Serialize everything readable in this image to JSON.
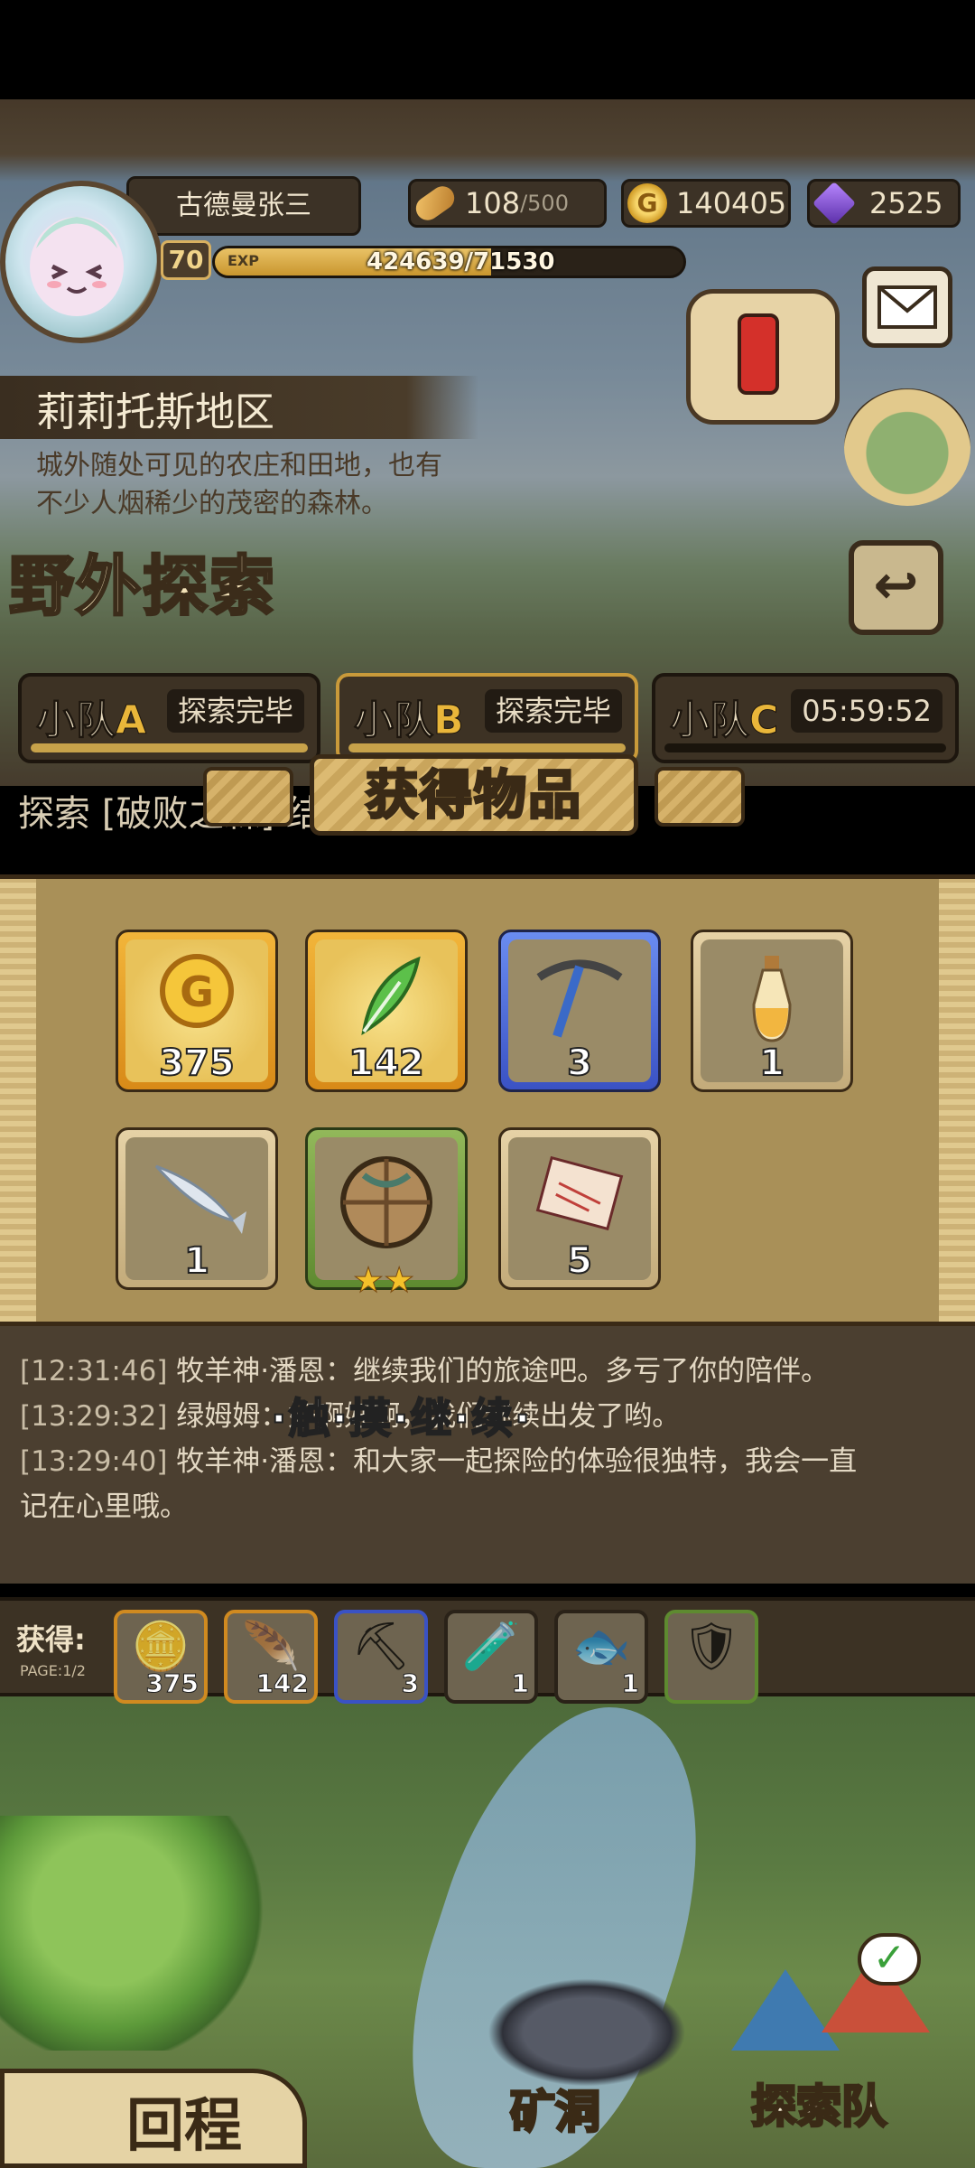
{
  "player": {
    "name": "古德曼张三",
    "level": "70",
    "exp_label": "EXP",
    "exp_value": "424639/71530",
    "exp_progress": 0.59
  },
  "resources": {
    "stamina_current": "108",
    "stamina_max": "/500",
    "gold": "140405",
    "gems": "2525",
    "gold_icon_glyph": "G"
  },
  "region": {
    "name": "莉莉托斯地区",
    "description_line1": "城外随处可见的农庄和田地，也有",
    "description_line2": "不少人烟稀少的茂密的森林。",
    "mode_title": "野外探索"
  },
  "squads": [
    {
      "prefix": "小队",
      "letter": "A",
      "status": "探索完毕",
      "progress": 1.0
    },
    {
      "prefix": "小队",
      "letter": "B",
      "status": "探索完毕",
      "progress": 1.0
    },
    {
      "prefix": "小队",
      "letter": "C",
      "status": "05:59:52",
      "progress": 0.0
    }
  ],
  "explore_line": "探索 [破败之森] 结束",
  "dialog": {
    "title": "获得物品",
    "items": [
      {
        "name": "gold-coin",
        "count": "375",
        "rarity": "gold"
      },
      {
        "name": "green-feather",
        "count": "142",
        "rarity": "gold"
      },
      {
        "name": "pickaxe",
        "count": "3",
        "rarity": "blue"
      },
      {
        "name": "potion-bottle",
        "count": "1",
        "rarity": "plain"
      },
      {
        "name": "fish",
        "count": "1",
        "rarity": "plain"
      },
      {
        "name": "wooden-shield",
        "count": "",
        "rarity": "green",
        "stars": 2
      },
      {
        "name": "scroll",
        "count": "5",
        "rarity": "plain"
      }
    ],
    "touch_hint": "·触·摸·继·续·"
  },
  "chat": [
    {
      "ts": "[12:31:46]",
      "text": " 牧羊神·潘恩：继续我们的旅途吧。多亏了你的陪伴。"
    },
    {
      "ts": "[13:29:32]",
      "text": " 绿姆姆：好啊好啊，我们继续出发了哟。"
    },
    {
      "ts": "[13:29:40]",
      "text": " 牧羊神·潘恩：和大家一起探险的体验很独特，我会一直"
    },
    {
      "ts": "",
      "text": "记在心里哦。"
    }
  ],
  "loot_bar": {
    "label": "获得:",
    "page": "PAGE:1/2",
    "items": [
      {
        "count": "375",
        "rarity": "gold"
      },
      {
        "count": "142",
        "rarity": "gold"
      },
      {
        "count": "3",
        "rarity": "blue"
      },
      {
        "count": "1",
        "rarity": "plain"
      },
      {
        "count": "1",
        "rarity": "plain"
      },
      {
        "count": "",
        "rarity": "green"
      }
    ]
  },
  "map": {
    "return_label": "回程",
    "mine_label": "矿洞",
    "team_label": "探索队"
  },
  "colors": {
    "accent_gold": "#e9b63a",
    "panel_brown": "#3c3226",
    "chat_bg": "#4b3f30"
  }
}
